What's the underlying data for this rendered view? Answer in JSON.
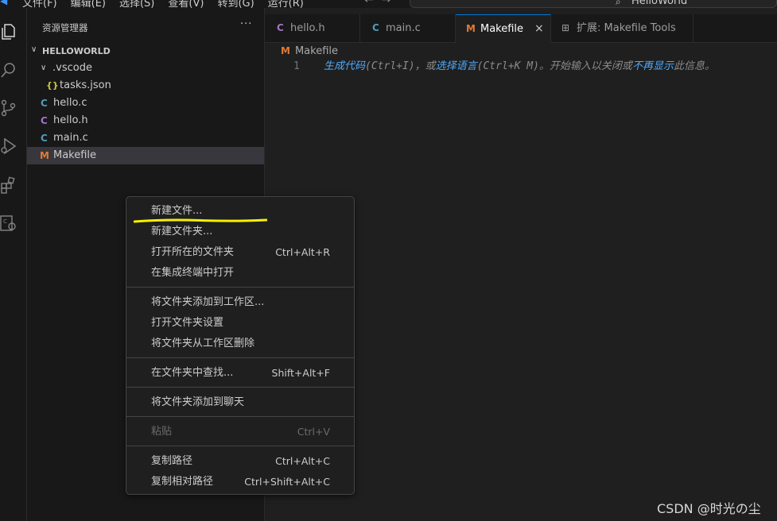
{
  "menubar": {
    "items": [
      "文件(F)",
      "编辑(E)",
      "选择(S)",
      "查看(V)",
      "转到(G)",
      "运行(R)",
      "···"
    ],
    "command_center_text": "HelloWorld"
  },
  "activity_bar": {
    "icons": [
      "explorer-icon",
      "search-icon",
      "source-control-icon",
      "run-debug-icon",
      "extensions-icon",
      "makefile-tools-icon"
    ]
  },
  "explorer": {
    "title": "资源管理器",
    "more": "···",
    "folder": "HELLOWORLD",
    "items": [
      {
        "label": ".vscode",
        "icon": "",
        "kind": "folder"
      },
      {
        "label": "tasks.json",
        "icon": "{}",
        "kind": "json"
      },
      {
        "label": "hello.c",
        "icon": "C",
        "kind": "c"
      },
      {
        "label": "hello.h",
        "icon": "C",
        "kind": "h"
      },
      {
        "label": "main.c",
        "icon": "C",
        "kind": "c"
      },
      {
        "label": "Makefile",
        "icon": "M",
        "kind": "makefile"
      }
    ]
  },
  "tabs": [
    {
      "label": "hello.h",
      "icon": "C"
    },
    {
      "label": "main.c",
      "icon": "C"
    },
    {
      "label": "Makefile",
      "icon": "M",
      "close": "×"
    },
    {
      "label": "扩展: Makefile Tools",
      "icon": "⊞"
    }
  ],
  "breadcrumb": {
    "icon": "M",
    "label": "Makefile"
  },
  "editor": {
    "line_number": "1",
    "hint": {
      "link1": "生成代码",
      "text1": "(Ctrl+I)，或",
      "link2": "选择语言",
      "text2": "(Ctrl+K M)。开始输入以关闭或",
      "link3": "不再显示",
      "text3": "此信息。"
    }
  },
  "context_menu": {
    "items": [
      {
        "label": "新建文件...",
        "shortcut": ""
      },
      {
        "label": "新建文件夹...",
        "shortcut": ""
      },
      {
        "label": "打开所在的文件夹",
        "shortcut": "Ctrl+Alt+R"
      },
      {
        "label": "在集成终端中打开",
        "shortcut": ""
      },
      {
        "label": "将文件夹添加到工作区...",
        "shortcut": ""
      },
      {
        "label": "打开文件夹设置",
        "shortcut": ""
      },
      {
        "label": "将文件夹从工作区删除",
        "shortcut": ""
      },
      {
        "label": "在文件夹中查找...",
        "shortcut": "Shift+Alt+F"
      },
      {
        "label": "将文件夹添加到聊天",
        "shortcut": ""
      },
      {
        "label": "粘贴",
        "shortcut": "Ctrl+V",
        "disabled": true
      },
      {
        "label": "复制路径",
        "shortcut": "Ctrl+Alt+C"
      },
      {
        "label": "复制相对路径",
        "shortcut": "Ctrl+Shift+Alt+C"
      }
    ],
    "highlight_color": "#f6f000"
  },
  "watermark": "CSDN @时光の尘",
  "colors": {
    "accent": "#0078d4",
    "link": "#4daafc"
  }
}
